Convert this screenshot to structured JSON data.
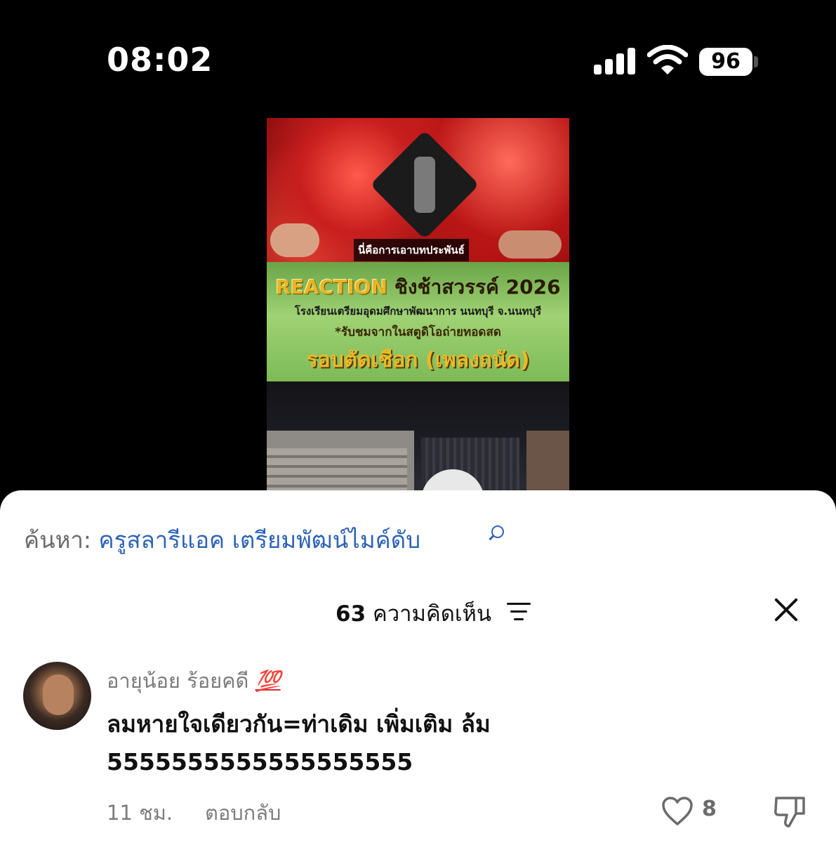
{
  "status_bar": {
    "time": "08:02",
    "battery": "96",
    "icons": [
      "cellular-signal-icon",
      "wifi-icon",
      "battery-icon"
    ]
  },
  "video": {
    "caption": "นี่คือการเอาบทประพันธ์",
    "banner": {
      "title_en": "REACTION",
      "title_th": "ชิงช้าสวรรค์ 2026",
      "school": "โรงเรียนเตรียมอุดมศึกษาพัฒนาการ นนทบุรี จ.นนทบุรี",
      "note": "*รับชมจากในสตูดิโอถ่ายทอดสด",
      "round": "รอบตัดเชือก (เพลงถนัด)"
    }
  },
  "search": {
    "prefix": "ค้นหา:",
    "query": "ครูสลารีแอค เตรียมพัฒน์ไมค์ดับ"
  },
  "comments_header": {
    "count": "63",
    "label": "ความคิดเห็น"
  },
  "comment": {
    "username": "อายุน้อย ร้อยคดี",
    "username_emoji": "💯",
    "text": "ลมหายใจเดียวกัน=ท่าเดิม เพิ่มเติม ล้ม 5555555555555555555",
    "time": "11 ชม.",
    "reply_label": "ตอบกลับ",
    "likes": "8"
  },
  "colors": {
    "link_blue": "#2d63b8",
    "muted_text": "#7a7a7a",
    "accent_red": "#e2233b"
  }
}
